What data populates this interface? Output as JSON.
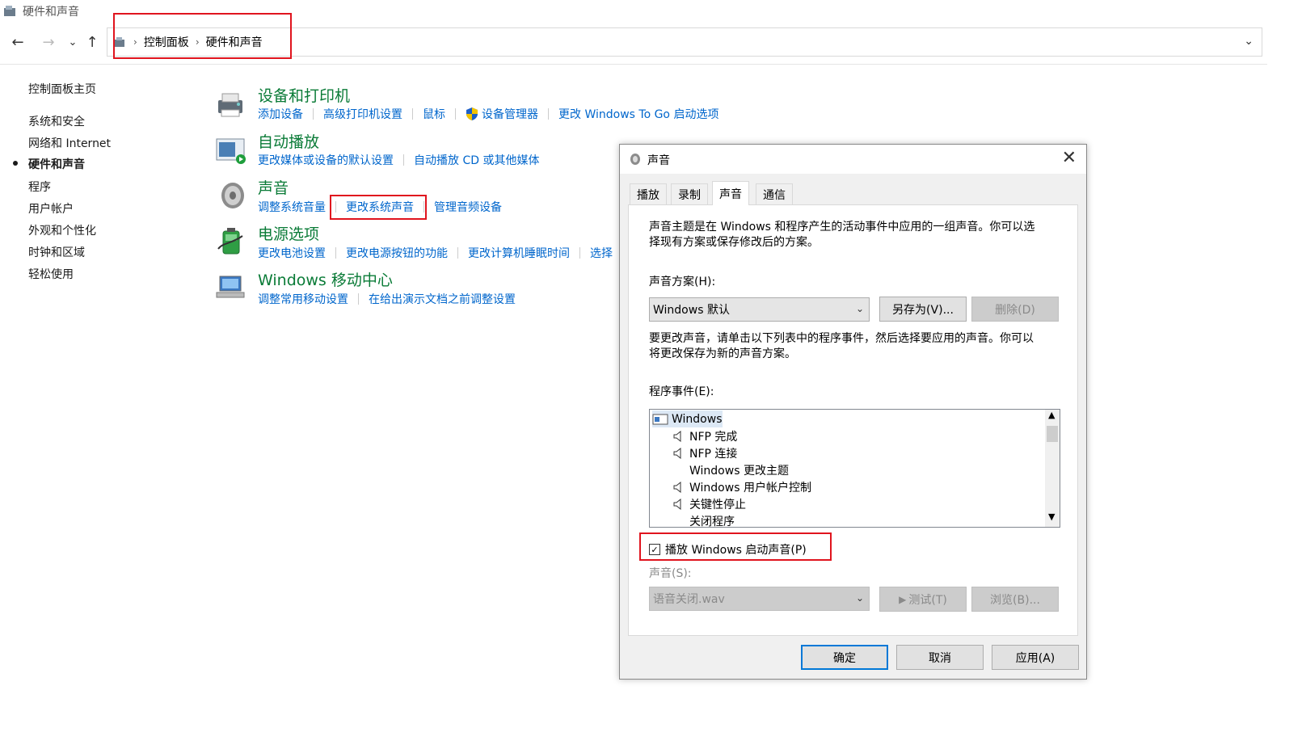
{
  "window": {
    "title": "硬件和声音",
    "icon": "control-panel-icon"
  },
  "nav": {
    "back": "←",
    "forward": "→",
    "dropdown": "⌄",
    "up": "↑",
    "breadcrumb": [
      "控制面板",
      "硬件和声音"
    ]
  },
  "sidebar": {
    "items": [
      {
        "label": "控制面板主页"
      },
      {
        "label": "系统和安全"
      },
      {
        "label": "网络和 Internet"
      },
      {
        "label": "硬件和声音",
        "active": true
      },
      {
        "label": "程序"
      },
      {
        "label": "用户帐户"
      },
      {
        "label": "外观和个性化"
      },
      {
        "label": "时钟和区域"
      },
      {
        "label": "轻松使用"
      }
    ]
  },
  "categories": [
    {
      "title": "设备和打印机",
      "icon": "printer-icon",
      "links": [
        "添加设备",
        "高级打印机设置",
        "鼠标",
        "设备管理器",
        "更改 Windows To Go 启动选项"
      ]
    },
    {
      "title": "自动播放",
      "icon": "autoplay-icon",
      "links": [
        "更改媒体或设备的默认设置",
        "自动播放 CD 或其他媒体"
      ]
    },
    {
      "title": "声音",
      "icon": "speaker-icon",
      "links": [
        "调整系统音量",
        "更改系统声音",
        "管理音频设备"
      ]
    },
    {
      "title": "电源选项",
      "icon": "battery-icon",
      "links": [
        "更改电池设置",
        "更改电源按钮的功能",
        "更改计算机睡眠时间",
        "选择"
      ]
    },
    {
      "title": "Windows 移动中心",
      "icon": "laptop-icon",
      "links": [
        "调整常用移动设置",
        "在给出演示文档之前调整设置"
      ]
    }
  ],
  "dialog": {
    "title": "声音",
    "close": "✕",
    "tabs": [
      "播放",
      "录制",
      "声音",
      "通信"
    ],
    "selected_tab": "声音",
    "intro_line1": "声音主题是在 Windows 和程序产生的活动事件中应用的一组声音。你可以选",
    "intro_line2": "择现有方案或保存修改后的方案。",
    "scheme_label": "声音方案(H):",
    "scheme_value": "Windows 默认",
    "save_as": "另存为(V)...",
    "delete": "删除(D)",
    "help_line1": "要更改声音，请单击以下列表中的程序事件，然后选择要应用的声音。你可以",
    "help_line2": "将更改保存为新的声音方案。",
    "events_label": "程序事件(E):",
    "events": [
      {
        "label": "Windows",
        "root": true
      },
      {
        "label": "NFP 完成",
        "sound": true
      },
      {
        "label": "NFP 连接",
        "sound": true
      },
      {
        "label": "Windows 更改主题",
        "sound": false
      },
      {
        "label": "Windows 用户帐户控制",
        "sound": true
      },
      {
        "label": "关键性停止",
        "sound": true
      },
      {
        "label": "关闭程序",
        "sound": false
      }
    ],
    "startup_checkbox": "播放 Windows 启动声音(P)",
    "startup_checked": true,
    "sound_label": "声音(S):",
    "sound_value": "语音关闭.wav",
    "test": "测试(T)",
    "browse": "浏览(B)...",
    "ok": "确定",
    "cancel": "取消",
    "apply": "应用(A)"
  }
}
